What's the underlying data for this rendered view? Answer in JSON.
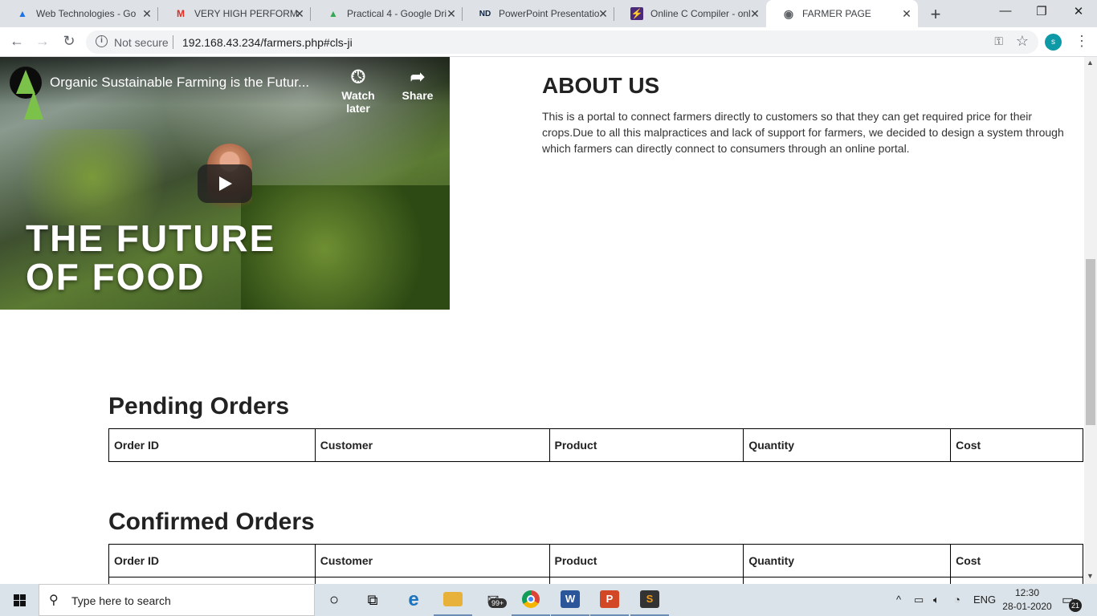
{
  "browser": {
    "tabs": [
      {
        "label": "Web Technologies - Go",
        "icon": "google-drive-icon",
        "icon_glyph": "▲",
        "color": "#1a73e8"
      },
      {
        "label": "VERY HIGH PERFORMA",
        "icon": "gmail-icon",
        "icon_glyph": "M",
        "color": "#d93025"
      },
      {
        "label": "Practical 4 - Google Dri",
        "icon": "google-drive-icon",
        "icon_glyph": "▲",
        "color": "#34a853"
      },
      {
        "label": "PowerPoint Presentatio",
        "icon": "notre-dame-icon",
        "icon_glyph": "ND",
        "color": "#0c2340"
      },
      {
        "label": "Online C Compiler - onl",
        "icon": "compiler-icon",
        "icon_glyph": "⚡",
        "color": "#4b2a7b"
      },
      {
        "label": "FARMER PAGE",
        "icon": "globe-icon",
        "icon_glyph": "◉",
        "color": "#5f6368"
      }
    ],
    "new_tab": "+",
    "window": {
      "minimize": "—",
      "restore": "❐",
      "close": "✕"
    },
    "nav": {
      "back": "←",
      "forward": "→",
      "reload": "↻"
    },
    "address": {
      "security_text": "Not secure",
      "url": "192.168.43.234/farmers.php#cls-ji",
      "info_glyph": "i"
    },
    "icons": {
      "key": "⚿",
      "star": "☆",
      "menu": "⋮"
    },
    "profile_initial": "s"
  },
  "video": {
    "title": "Organic Sustainable Farming is the Futur...",
    "watch_later": "Watch later",
    "share": "Share",
    "overlay_line1": "THE FUTURE",
    "overlay_line2": "OF FOOD"
  },
  "about": {
    "heading": "ABOUT US",
    "text": "This is a portal to connect farmers directly to customers so that they can get required price for their crops.Due to all this malpractices and lack of support for farmers, we decided to design a system through which farmers can directly connect to consumers through an online portal."
  },
  "pending": {
    "heading": "Pending Orders",
    "columns": [
      "Order ID",
      "Customer",
      "Product",
      "Quantity",
      "Cost"
    ]
  },
  "confirmed": {
    "heading": "Confirmed Orders",
    "columns": [
      "Order ID",
      "Customer",
      "Product",
      "Quantity",
      "Cost"
    ]
  },
  "taskbar": {
    "search_placeholder": "Type here to search",
    "mail_badge": "99+",
    "tray": {
      "caret": "^",
      "language": "ENG"
    },
    "time": "12:30",
    "date": "28-01-2020",
    "notifications": "21",
    "apps": [
      {
        "name": "cortana",
        "glyph": "○",
        "color": "#111"
      },
      {
        "name": "task-view",
        "glyph": "⧉",
        "color": "#111"
      },
      {
        "name": "edge",
        "glyph": "e",
        "color": "#1e73be"
      },
      {
        "name": "file-explorer",
        "glyph": "▬",
        "color": "#e8b13a"
      },
      {
        "name": "mail",
        "glyph": "✉",
        "color": "#333"
      },
      {
        "name": "chrome",
        "glyph": "◍",
        "color": "#db4437"
      },
      {
        "name": "word",
        "glyph": "W",
        "color": "#2b579a"
      },
      {
        "name": "powerpoint",
        "glyph": "P",
        "color": "#d24726"
      },
      {
        "name": "sublime-text",
        "glyph": "S",
        "color": "#f29b1a"
      }
    ]
  }
}
